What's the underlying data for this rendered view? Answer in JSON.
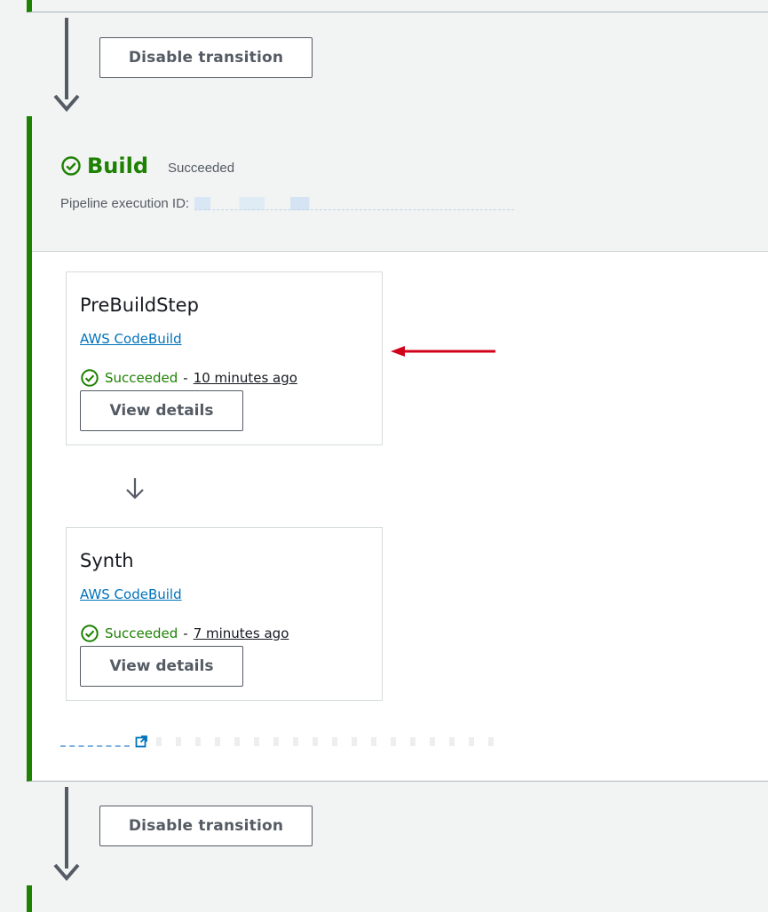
{
  "transition_button_label": "Disable transition",
  "stage": {
    "title": "Build",
    "status": "Succeeded",
    "execution_label": "Pipeline execution ID:"
  },
  "actions": [
    {
      "name": "PreBuildStep",
      "provider": "AWS CodeBuild",
      "status": "Succeeded",
      "separator": "-",
      "time": "10 minutes ago",
      "button": "View details"
    },
    {
      "name": "Synth",
      "provider": "AWS CodeBuild",
      "status": "Succeeded",
      "separator": "-",
      "time": "7 minutes ago",
      "button": "View details"
    }
  ],
  "colors": {
    "success": "#1d8102",
    "link": "#0073bb",
    "annotation": "#d0021b"
  },
  "icons": {
    "status": "check-circle-icon",
    "external": "external-link-icon",
    "transition": "arrow-down-icon"
  }
}
